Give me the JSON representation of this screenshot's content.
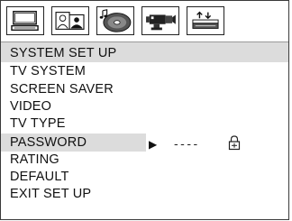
{
  "toolbar": {
    "icons": [
      {
        "name": "system-setup-monitor-icon",
        "active": true
      },
      {
        "name": "language-people-icon",
        "active": false
      },
      {
        "name": "audio-disc-icon",
        "active": false
      },
      {
        "name": "video-camera-icon",
        "active": false
      },
      {
        "name": "speaker-eq-icon",
        "active": false
      }
    ]
  },
  "menu": {
    "title": "SYSTEM SET UP",
    "items": [
      {
        "label": "TV SYSTEM",
        "selected": false
      },
      {
        "label": "SCREEN SAVER",
        "selected": false
      },
      {
        "label": "VIDEO",
        "selected": false
      },
      {
        "label": "TV TYPE",
        "selected": false
      },
      {
        "label": "PASSWORD",
        "selected": true
      },
      {
        "label": "RATING",
        "selected": false
      },
      {
        "label": "DEFAULT",
        "selected": false
      },
      {
        "label": "EXIT SET UP",
        "selected": false
      }
    ]
  },
  "password": {
    "arrow": "▶",
    "value": "----",
    "lock_icon": "lock-icon"
  },
  "colors": {
    "highlight": "#dcdcdc",
    "text": "#111111",
    "border": "#222222"
  }
}
